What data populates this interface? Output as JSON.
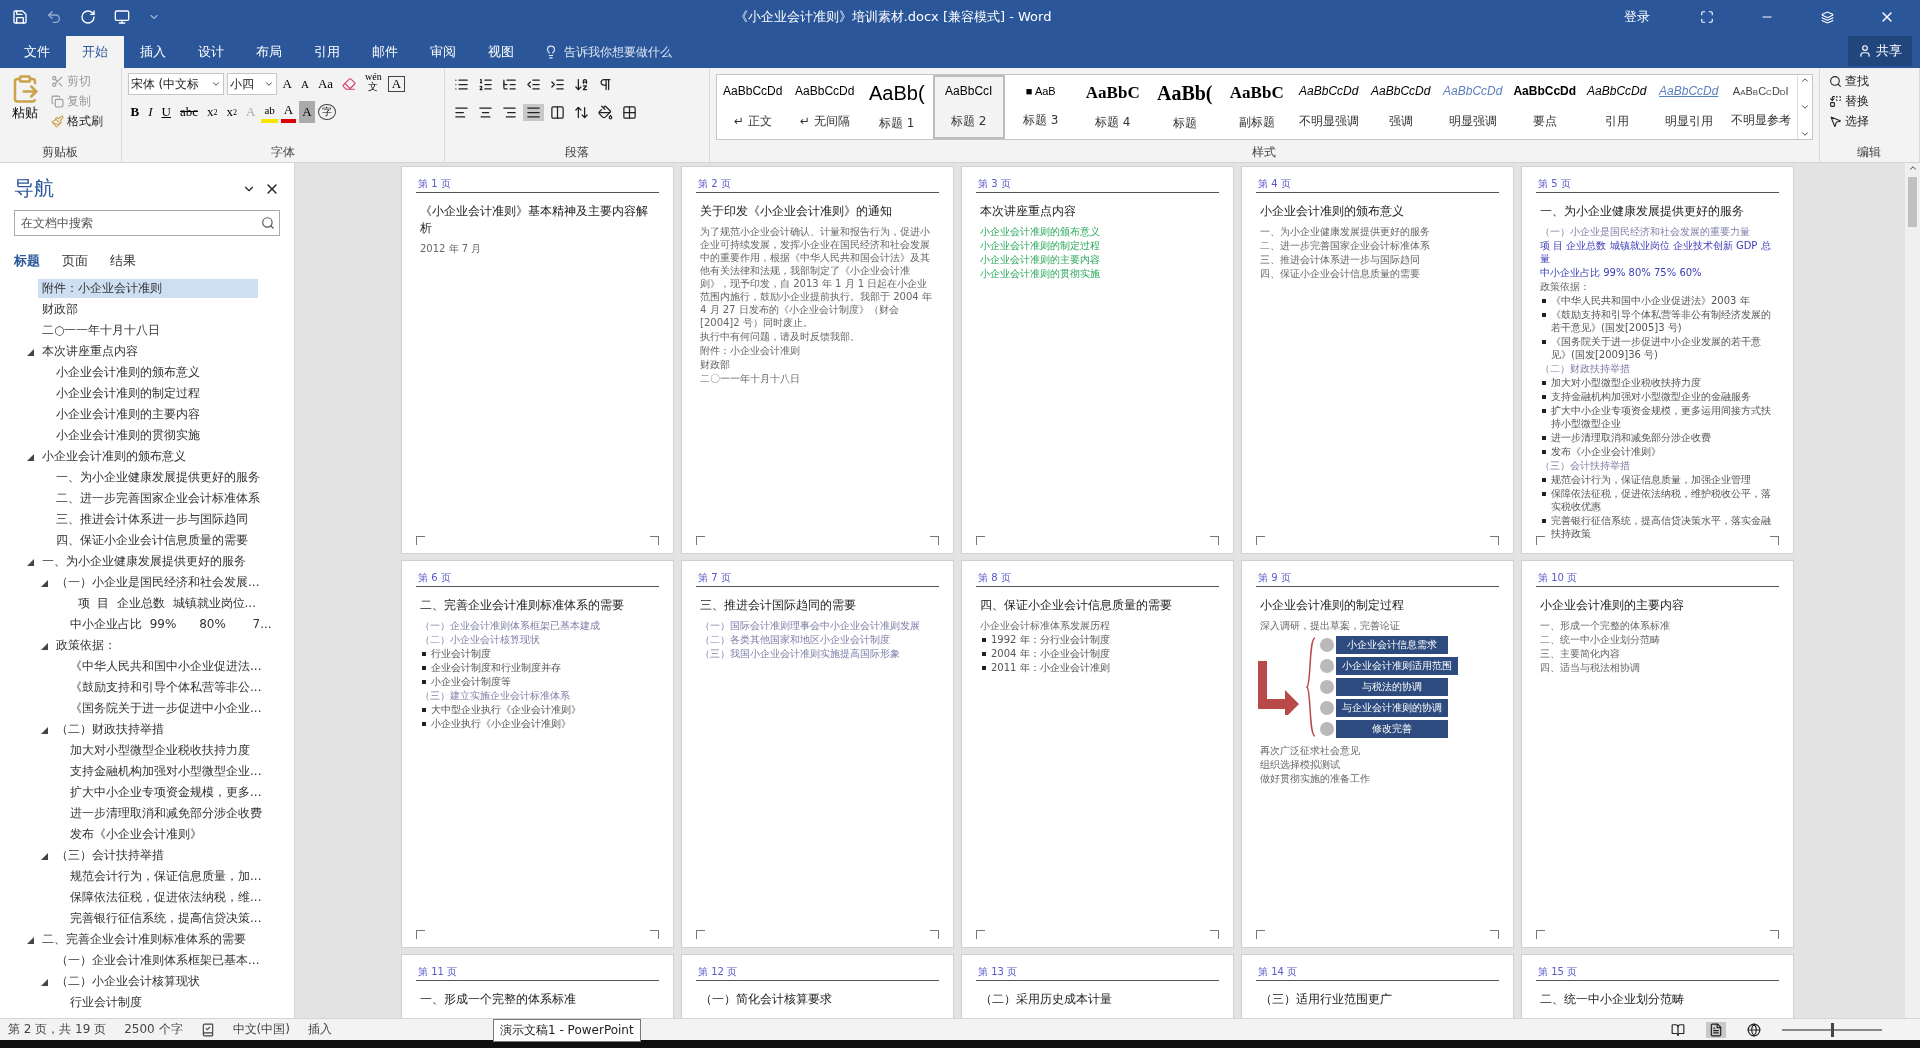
{
  "window": {
    "title": "《小企业会计准则》培训素材.docx [兼容模式]  -  Word",
    "sign_in": "登录"
  },
  "ribbon_tabs": [
    {
      "label": "文件",
      "selected": false
    },
    {
      "label": "开始",
      "selected": true
    },
    {
      "label": "插入",
      "selected": false
    },
    {
      "label": "设计",
      "selected": false
    },
    {
      "label": "布局",
      "selected": false
    },
    {
      "label": "引用",
      "selected": false
    },
    {
      "label": "邮件",
      "selected": false
    },
    {
      "label": "审阅",
      "selected": false
    },
    {
      "label": "视图",
      "selected": false
    }
  ],
  "tell_me": {
    "placeholder": "告诉我你想要做什么"
  },
  "share": "共享",
  "clipboard": {
    "paste": "粘贴",
    "cut": "剪切",
    "copy": "复制",
    "format_painter": "格式刷",
    "label": "剪贴板"
  },
  "font": {
    "name": "宋体 (中文标",
    "size": "小四",
    "change_case": "Aa",
    "phonetic": "wén",
    "phonetic_char": "文",
    "boxed": "A",
    "bold": "B",
    "italic": "I",
    "underline": "U",
    "strike": "abc",
    "sub": "x",
    "sub_mark": "2",
    "sup": "x",
    "sup_mark": "2",
    "effects": "A",
    "highlight": "ab",
    "font_color_letter": "A",
    "shading": "A",
    "enclose": "字",
    "grow": "A",
    "shrink": "A",
    "label": "字体"
  },
  "paragraph": {
    "label": "段落"
  },
  "styles": {
    "label": "样式",
    "items": [
      {
        "preview": "AaBbCcDd",
        "name": "↵ 正文",
        "kind": "normal",
        "selected": false
      },
      {
        "preview": "AaBbCcDd",
        "name": "↵ 无间隔",
        "kind": "normal",
        "selected": false
      },
      {
        "preview": "AaBb(",
        "name": "标题 1",
        "kind": "heading",
        "selected": false
      },
      {
        "preview": "AaBbCcI",
        "name": "标题 2",
        "kind": "normal",
        "selected": true
      },
      {
        "preview": "■  AaB",
        "name": "标题 3",
        "kind": "small",
        "selected": false
      },
      {
        "preview": "AaBbC",
        "name": "标题 4",
        "kind": "serif",
        "selected": false
      },
      {
        "preview": "AaBb(",
        "name": "标题",
        "kind": "serif-big",
        "selected": false
      },
      {
        "preview": "AaBbC",
        "name": "副标题",
        "kind": "serif",
        "selected": false
      },
      {
        "preview": "AaBbCcDd",
        "name": "不明显强调",
        "kind": "italic",
        "selected": false
      },
      {
        "preview": "AaBbCcDd",
        "name": "强调",
        "kind": "italic",
        "selected": false
      },
      {
        "preview": "AaBbCcDd",
        "name": "明显强调",
        "kind": "accent",
        "selected": false
      },
      {
        "preview": "AaBbCcDd",
        "name": "要点",
        "kind": "bold",
        "selected": false
      },
      {
        "preview": "AaBbCcDd",
        "name": "引用",
        "kind": "italic",
        "selected": false
      },
      {
        "preview": "AaBbCcDd",
        "name": "明显引用",
        "kind": "quote",
        "selected": false
      },
      {
        "preview": "AaBbCcDdI",
        "name": "不明显参考",
        "kind": "caps",
        "selected": false
      }
    ]
  },
  "editing": {
    "find": "查找",
    "replace": "替换",
    "select": "选择",
    "label": "编辑"
  },
  "navigation": {
    "title": "导航",
    "search": {
      "placeholder": "在文档中搜索"
    },
    "tabs": [
      {
        "label": "标题",
        "selected": true
      },
      {
        "label": "页面",
        "selected": false
      },
      {
        "label": "结果",
        "selected": false
      }
    ],
    "tree": [
      {
        "label": "附件：小企业会计准则",
        "selected": true
      },
      {
        "label": "财政部",
        "selected": false
      },
      {
        "label": "二○一一年十月十八日",
        "selected": false
      },
      {
        "label": "本次讲座重点内容",
        "selected": false,
        "expanded": true,
        "children": [
          {
            "label": "小企业会计准则的颁布意义",
            "selected": false
          },
          {
            "label": "小企业会计准则的制定过程",
            "selected": false
          },
          {
            "label": "小企业会计准则的主要内容",
            "selected": false
          },
          {
            "label": "小企业会计准则的贯彻实施",
            "selected": false
          }
        ]
      },
      {
        "label": "小企业会计准则的颁布意义",
        "selected": false,
        "expanded": true,
        "children": [
          {
            "label": "一、为小企业健康发展提供更好的服务",
            "selected": false
          },
          {
            "label": "二、进一步完善国家企业会计标准体系",
            "selected": false
          },
          {
            "label": "三、推进会计体系进一步与国际趋同",
            "selected": false
          },
          {
            "label": "四、保证小企业会计信息质量的需要",
            "selected": false
          }
        ]
      },
      {
        "label": "一、为小企业健康发展提供更好的服务",
        "selected": false,
        "expanded": true,
        "children": [
          {
            "label": "（一）小企业是国民经济和社会发展...",
            "selected": false,
            "expanded": true,
            "children": [
              {
                "label": "  项  目  企业总数  城镇就业岗位...",
                "selected": false
              },
              {
                "label": "中小企业占比  99%      80%       7...",
                "selected": false
              }
            ]
          },
          {
            "label": "政策依据：",
            "selected": false,
            "expanded": true,
            "children": [
              {
                "label": "《中华人民共和国中小企业促进法...",
                "selected": false
              },
              {
                "label": "《鼓励支持和引导个体私营等非公...",
                "selected": false
              },
              {
                "label": "《国务院关于进一步促进中小企业...",
                "selected": false
              }
            ]
          },
          {
            "label": "（二）财政扶持举措",
            "selected": false,
            "expanded": true,
            "children": [
              {
                "label": "加大对小型微型企业税收扶持力度",
                "selected": false
              },
              {
                "label": "支持金融机构加强对小型微型企业...",
                "selected": false
              },
              {
                "label": "扩大中小企业专项资金规模，更多...",
                "selected": false
              },
              {
                "label": "进一步清理取消和减免部分涉企收费",
                "selected": false
              },
              {
                "label": "发布《小企业会计准则》",
                "selected": false
              }
            ]
          },
          {
            "label": "（三）会计扶持举措",
            "selected": false,
            "expanded": true,
            "children": [
              {
                "label": "规范会计行为，保证信息质量，加...",
                "selected": false
              },
              {
                "label": "保障依法征税，促进依法纳税，维...",
                "selected": false
              },
              {
                "label": "完善银行征信系统，提高信贷决策...",
                "selected": false
              }
            ]
          }
        ]
      },
      {
        "label": "二、完善企业会计准则标准体系的需要",
        "selected": false,
        "expanded": true,
        "children": [
          {
            "label": "（一）企业会计准则体系框架已基本...",
            "selected": false
          },
          {
            "label": "（二）小企业会计核算现状",
            "selected": false,
            "expanded": true,
            "children": [
              {
                "label": "行业会计制度",
                "selected": false
              }
            ]
          }
        ]
      }
    ]
  },
  "pages": [
    {
      "label": "第 1 页",
      "title": "《小企业会计准则》基本精神及主要内容解析",
      "lines": [
        {
          "text": "2012 年 7 月",
          "kind": "plain"
        }
      ]
    },
    {
      "label": "第 2 页",
      "title": "关于印发《小企业会计准则》的通知",
      "lines": [
        {
          "text": "为了规范小企业会计确认、计量和报告行为，促进小企业可持续发展，发挥小企业在国民经济和社会发展中的重要作用，根据《中华人民共和国会计法》及其他有关法律和法规，我部制定了《小企业会计准则》，现予印发，自 2013 年 1 月 1 日起在小企业范围内施行，鼓励小企业提前执行。我部于 2004 年 4 月 27 日发布的《小企业会计制度》（财会[2004]2 号）同时废止。",
          "kind": "plain"
        },
        {
          "text": "执行中有何问题，请及时反馈我部。",
          "kind": "plain"
        },
        {
          "text": "附件：小企业会计准则",
          "kind": "plain"
        },
        {
          "text": "财政部",
          "kind": "plain"
        },
        {
          "text": "二〇一一年十月十八日",
          "kind": "plain"
        }
      ]
    },
    {
      "label": "第 3 页",
      "title": "本次讲座重点内容",
      "lines": [
        {
          "text": "小企业会计准则的颁布意义",
          "kind": "green"
        },
        {
          "text": "小企业会计准则的制定过程",
          "kind": "green"
        },
        {
          "text": "小企业会计准则的主要内容",
          "kind": "green"
        },
        {
          "text": "小企业会计准则的贯彻实施",
          "kind": "green"
        }
      ]
    },
    {
      "label": "第 4 页",
      "title": "小企业会计准则的颁布意义",
      "lines": [
        {
          "text": "一、为小企业健康发展提供更好的服务",
          "kind": "plain"
        },
        {
          "text": "二、进一步完善国家企业会计标准体系",
          "kind": "plain"
        },
        {
          "text": "三、推进会计体系进一步与国际趋同",
          "kind": "plain"
        },
        {
          "text": "四、保证小企业会计信息质量的需要",
          "kind": "plain"
        }
      ]
    },
    {
      "label": "第 5 页",
      "title": "一、为小企业健康发展提供更好的服务",
      "lines": [
        {
          "text": "（一）小企业是国民经济和社会发展的重要力量",
          "kind": "sub"
        },
        {
          "text": "项 目  企业总数  城镇就业岗位  企业技术创新  GDP 总量",
          "kind": "table"
        },
        {
          "text": "中小企业占比  99%  80%  75%  60%",
          "kind": "table"
        },
        {
          "text": "政策依据：",
          "kind": "plain"
        },
        {
          "text": "《中华人民共和国中小企业促进法》2003 年",
          "kind": "bullet"
        },
        {
          "text": "《鼓励支持和引导个体私营等非公有制经济发展的若干意见》(国发[2005]3 号)",
          "kind": "bullet"
        },
        {
          "text": "《国务院关于进一步促进中小企业发展的若干意见》(国发[2009]36 号)",
          "kind": "bullet"
        },
        {
          "text": "（二）财政扶持举措",
          "kind": "sub"
        },
        {
          "text": "加大对小型微型企业税收扶持力度",
          "kind": "bullet"
        },
        {
          "text": "支持金融机构加强对小型微型企业的金融服务",
          "kind": "bullet"
        },
        {
          "text": "扩大中小企业专项资金规模，更多运用间接方式扶持小型微型企业",
          "kind": "bullet"
        },
        {
          "text": "进一步清理取消和减免部分涉企收费",
          "kind": "bullet"
        },
        {
          "text": "发布《小企业会计准则》",
          "kind": "bullet"
        },
        {
          "text": "（三）会计扶持举措",
          "kind": "sub"
        },
        {
          "text": "规范会计行为，保证信息质量，加强企业管理",
          "kind": "bullet"
        },
        {
          "text": "保障依法征税，促进依法纳税，维护税收公平，落实税收优惠",
          "kind": "bullet"
        },
        {
          "text": "完善银行征信系统，提高信贷决策水平，落实金融扶持政策",
          "kind": "bullet"
        }
      ]
    },
    {
      "label": "第 6 页",
      "title": "二、完善企业会计准则标准体系的需要",
      "lines": [
        {
          "text": "（一）企业会计准则体系框架已基本建成",
          "kind": "sub"
        },
        {
          "text": "（二）小企业会计核算现状",
          "kind": "sub"
        },
        {
          "text": "行业会计制度",
          "kind": "bullet"
        },
        {
          "text": "企业会计制度和行业制度并存",
          "kind": "bullet"
        },
        {
          "text": "小企业会计制度等",
          "kind": "bullet"
        },
        {
          "text": "（三）建立实施企业会计标准体系",
          "kind": "sub"
        },
        {
          "text": "大中型企业执行《企业会计准则》",
          "kind": "bullet"
        },
        {
          "text": "小企业执行《小企业会计准则》",
          "kind": "bullet"
        }
      ]
    },
    {
      "label": "第 7 页",
      "title": "三、推进会计国际趋同的需要",
      "lines": [
        {
          "text": "（一）国际会计准则理事会中小企业会计准则发展",
          "kind": "sub"
        },
        {
          "text": "（二）各类其他国家和地区小企业会计制度",
          "kind": "sub"
        },
        {
          "text": "（三）我国小企业会计准则实施提高国际形象",
          "kind": "sub"
        }
      ]
    },
    {
      "label": "第 8 页",
      "title": "四、保证小企业会计信息质量的需要",
      "lines": [
        {
          "text": "小企业会计标准体系发展历程",
          "kind": "plain"
        },
        {
          "text": "1992 年：分行业会计制度",
          "kind": "bullet"
        },
        {
          "text": "2004 年：小企业会计制度",
          "kind": "bullet"
        },
        {
          "text": "2011 年：小企业会计准则",
          "kind": "bullet"
        }
      ]
    },
    {
      "label": "第 9 页",
      "title": "小企业会计准则的制定过程",
      "lines": [
        {
          "text": "深入调研，提出草案，完善论证",
          "kind": "plain"
        }
      ],
      "diagram": [
        "小企业会计信息需求",
        "小企业会计准则适用范围",
        "与税法的协调",
        "与企业会计准则的协调",
        "修改完善"
      ],
      "after": [
        {
          "text": "再次广泛征求社会意见",
          "kind": "plain"
        },
        {
          "text": "组织选择模拟测试",
          "kind": "plain"
        },
        {
          "text": "做好贯彻实施的准备工作",
          "kind": "plain"
        }
      ]
    },
    {
      "label": "第 10 页",
      "title": "小企业会计准则的主要内容",
      "lines": [
        {
          "text": "一、形成一个完整的体系标准",
          "kind": "plain"
        },
        {
          "text": "二、统一中小企业划分范畴",
          "kind": "plain"
        },
        {
          "text": "三、主要简化内容",
          "kind": "plain"
        },
        {
          "text": "四、适当与税法相协调",
          "kind": "plain"
        }
      ]
    },
    {
      "label": "第 11 页",
      "title": "一、形成一个完整的体系标准"
    },
    {
      "label": "第 12 页",
      "title": "（一）简化会计核算要求"
    },
    {
      "label": "第 13 页",
      "title": "（二）采用历史成本计量"
    },
    {
      "label": "第 14 页",
      "title": "（三）适用行业范围更广"
    },
    {
      "label": "第 15 页",
      "title": "二、统一中小企业划分范畴"
    }
  ],
  "status_bar": {
    "page": "第 2 页，共 19 页",
    "words": "2500 个字",
    "language": "中文(中国)",
    "mode": "插入",
    "zoom": {
      "level": 0.5
    }
  },
  "tooltip": "演示文稿1 - PowerPoint"
}
